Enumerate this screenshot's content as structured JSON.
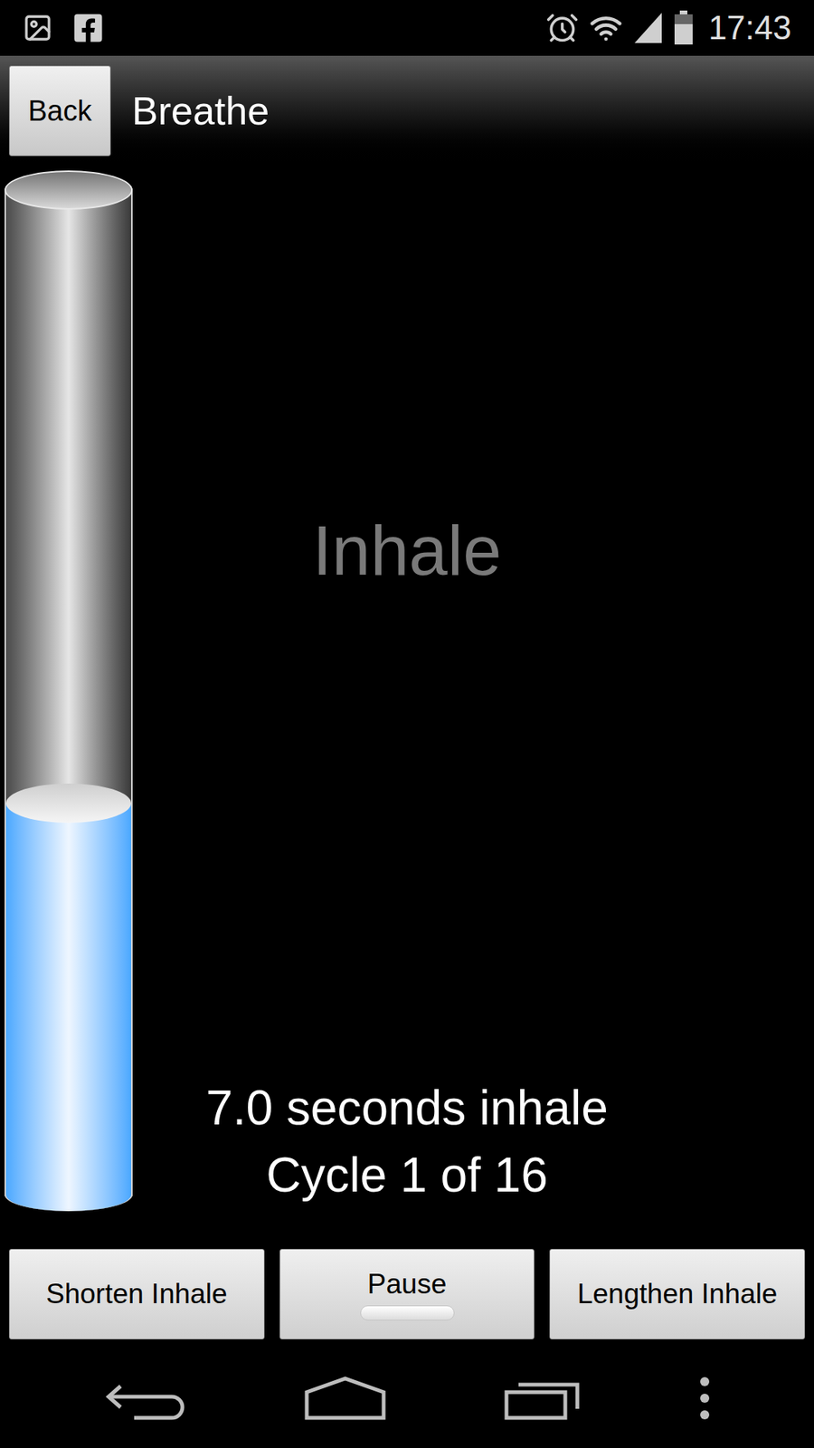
{
  "status_bar": {
    "time": "17:43"
  },
  "action_bar": {
    "back": "Back",
    "title": "Breathe"
  },
  "breath": {
    "phase": "Inhale",
    "level": 0.39,
    "duration": "7.0 seconds inhale",
    "cycle": "Cycle 1 of 16"
  },
  "buttons": [
    {
      "label": "Shorten Inhale",
      "kind": "plain"
    },
    {
      "label": "Pause",
      "kind": "indicator",
      "on": false
    },
    {
      "label": "Lengthen Inhale",
      "kind": "plain"
    }
  ]
}
